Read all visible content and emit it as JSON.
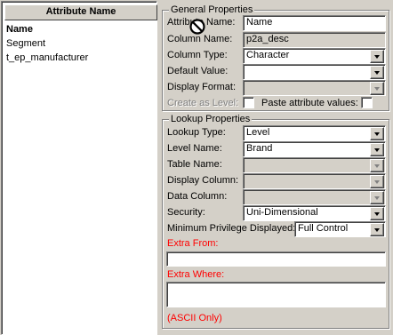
{
  "attributes": {
    "header": "Attribute Name",
    "items": [
      "Name",
      "Segment",
      "t_ep_manufacturer"
    ],
    "selected": "Name"
  },
  "general": {
    "title": "General Properties",
    "attribute_name_label": "Attribute Name:",
    "attribute_name_value": "Name",
    "column_name_label": "Column Name:",
    "column_name_value": "p2a_desc",
    "column_type_label": "Column Type:",
    "column_type_value": "Character",
    "default_value_label": "Default Value:",
    "default_value_value": "",
    "display_format_label": "Display Format:",
    "display_format_value": "",
    "create_as_level_label": "Create as Level:",
    "paste_attribute_values_label": "Paste attribute values:"
  },
  "lookup": {
    "title": "Lookup Properties",
    "lookup_type_label": "Lookup Type:",
    "lookup_type_value": "Level",
    "level_name_label": "Level Name:",
    "level_name_value": "Brand",
    "table_name_label": "Table Name:",
    "table_name_value": "",
    "display_column_label": "Display Column:",
    "display_column_value": "",
    "data_column_label": "Data Column:",
    "data_column_value": "",
    "security_label": "Security:",
    "security_value": "Uni-Dimensional",
    "min_privilege_label": "Minimum Privilege Displayed:",
    "min_privilege_value": "Full Control",
    "extra_from_label": "Extra From:",
    "extra_from_value": "",
    "extra_where_label": "Extra Where:",
    "extra_where_value": "",
    "ascii_note": "(ASCII Only)"
  },
  "icons": {
    "cursor": "not-allowed-cursor-icon"
  }
}
